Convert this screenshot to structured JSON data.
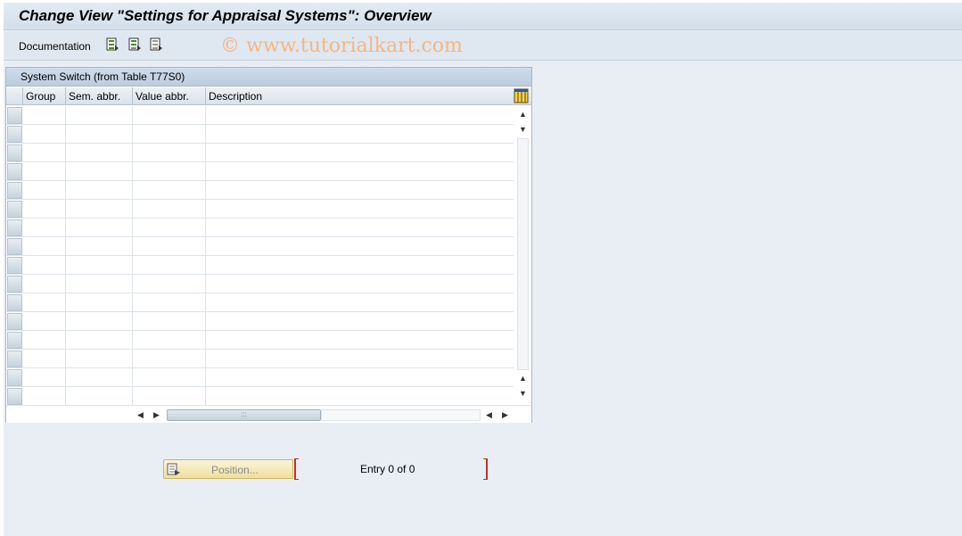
{
  "window": {
    "title": "Change View \"Settings for Appraisal Systems\": Overview"
  },
  "toolbar": {
    "documentation_label": "Documentation",
    "icons": [
      "select-all-icon",
      "select-block-icon",
      "deselect-all-icon"
    ],
    "watermark": "© www.tutorialkart.com"
  },
  "table": {
    "title": "System Switch (from Table T77S0)",
    "columns": [
      "Group",
      "Sem. abbr.",
      "Value abbr.",
      "Description"
    ],
    "rows": []
  },
  "footer": {
    "position_button_label": "Position...",
    "entry_text": "Entry 0 of 0"
  },
  "colors": {
    "background": "#e8eef4",
    "watermark": "#f0b886",
    "position_button": "#eedf9c",
    "bracket": "#c0302a"
  }
}
